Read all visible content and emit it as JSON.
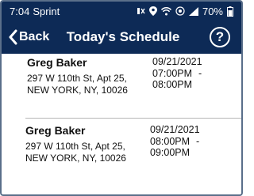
{
  "status_bar": {
    "time": "7:04",
    "carrier": "Sprint",
    "battery": "70%",
    "icons": [
      "mute-icon",
      "location-icon",
      "wifi-icon",
      "hotspot-icon",
      "signal-icon",
      "battery-icon"
    ]
  },
  "header": {
    "back_label": "Back",
    "title": "Today's Schedule",
    "help_label": "?"
  },
  "appointments": [
    {
      "name": "Greg Baker",
      "address_line1": "297 W 110th St, Apt 25,",
      "address_line2": "NEW YORK, NY, 10026",
      "date": "09/21/2021",
      "start": "07:00PM",
      "end": "- 08:00PM"
    },
    {
      "name": "Greg Baker",
      "address_line1": "297 W 110th St, Apt 25,",
      "address_line2": "NEW YORK, NY, 10026",
      "date": "09/21/2021",
      "start": "08:00PM",
      "end": "- 09:00PM"
    }
  ],
  "colors": {
    "header_bg": "#0d2a56",
    "divider": "#b5b5b5"
  }
}
